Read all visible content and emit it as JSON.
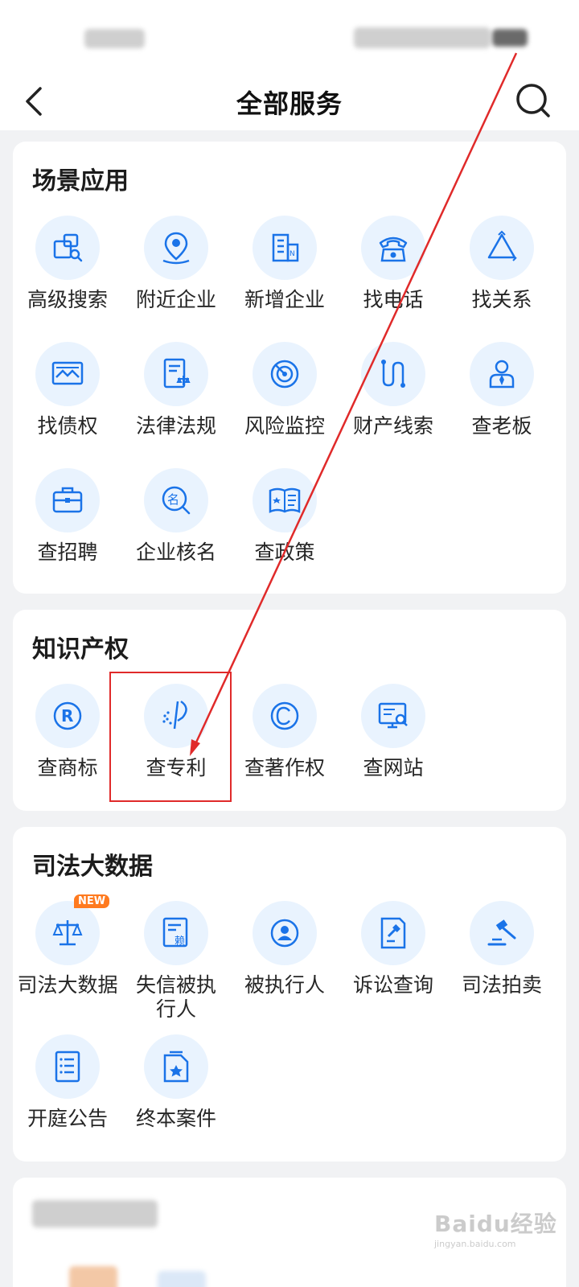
{
  "nav": {
    "title": "全部服务"
  },
  "colors": {
    "accent": "#1a73e8",
    "icon_bg": "#e9f3fe",
    "annotation": "#e02a2a",
    "badge": "#ff7a1f"
  },
  "sections": [
    {
      "title": "场景应用",
      "items": [
        {
          "label": "高级搜索",
          "icon": "advanced-search-icon"
        },
        {
          "label": "附近企业",
          "icon": "location-pin-icon"
        },
        {
          "label": "新增企业",
          "icon": "building-icon"
        },
        {
          "label": "找电话",
          "icon": "telephone-icon"
        },
        {
          "label": "找关系",
          "icon": "triangle-relation-icon"
        },
        {
          "label": "找债权",
          "icon": "debt-card-icon"
        },
        {
          "label": "法律法规",
          "icon": "law-book-icon"
        },
        {
          "label": "风险监控",
          "icon": "radar-icon"
        },
        {
          "label": "财产线索",
          "icon": "path-clue-icon"
        },
        {
          "label": "查老板",
          "icon": "boss-person-icon"
        },
        {
          "label": "查招聘",
          "icon": "briefcase-icon"
        },
        {
          "label": "企业核名",
          "icon": "name-check-icon"
        },
        {
          "label": "查政策",
          "icon": "policy-document-icon"
        }
      ]
    },
    {
      "title": "知识产权",
      "items": [
        {
          "label": "查商标",
          "icon": "trademark-icon"
        },
        {
          "label": "查专利",
          "icon": "patent-icon"
        },
        {
          "label": "查著作权",
          "icon": "copyright-icon"
        },
        {
          "label": "查网站",
          "icon": "website-search-icon"
        }
      ]
    },
    {
      "title": "司法大数据",
      "items": [
        {
          "label": "司法大数据",
          "icon": "scales-icon",
          "badge": "NEW"
        },
        {
          "label": "失信被执行人",
          "icon": "dishonest-list-icon"
        },
        {
          "label": "被执行人",
          "icon": "person-circle-icon"
        },
        {
          "label": "诉讼查询",
          "icon": "lawsuit-hammer-icon"
        },
        {
          "label": "司法拍卖",
          "icon": "auction-gavel-icon"
        },
        {
          "label": "开庭公告",
          "icon": "announcement-list-icon"
        },
        {
          "label": "终本案件",
          "icon": "case-star-icon"
        }
      ]
    }
  ],
  "watermark": {
    "brand": "Baidu经验",
    "sub": "jingyan.baidu.com"
  }
}
